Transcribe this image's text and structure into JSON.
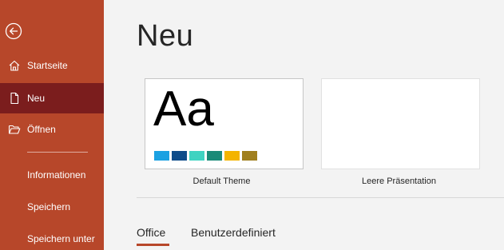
{
  "sidebar": {
    "back_icon": "back-arrow-icon",
    "items": [
      {
        "label": "Startseite",
        "icon": "home-icon"
      },
      {
        "label": "Neu",
        "icon": "new-document-icon"
      },
      {
        "label": "Öffnen",
        "icon": "folder-open-icon"
      },
      {
        "label": "Informationen"
      },
      {
        "label": "Speichern"
      },
      {
        "label": "Speichern unter"
      }
    ],
    "active_item": "Neu",
    "colors": {
      "background": "#b7472a",
      "active": "#7b1d1d"
    }
  },
  "main": {
    "title": "Neu",
    "templates": [
      {
        "label": "Default Theme",
        "preview_text": "Aa",
        "swatch_colors": [
          "#1ba1e2",
          "#0f4c8a",
          "#3fd3c1",
          "#1a8a78",
          "#f4b400",
          "#a07f1e"
        ]
      },
      {
        "label": "Leere Präsentation"
      }
    ],
    "tabs": [
      {
        "label": "Office",
        "active": true
      },
      {
        "label": "Benutzerdefiniert",
        "active": false
      }
    ]
  }
}
